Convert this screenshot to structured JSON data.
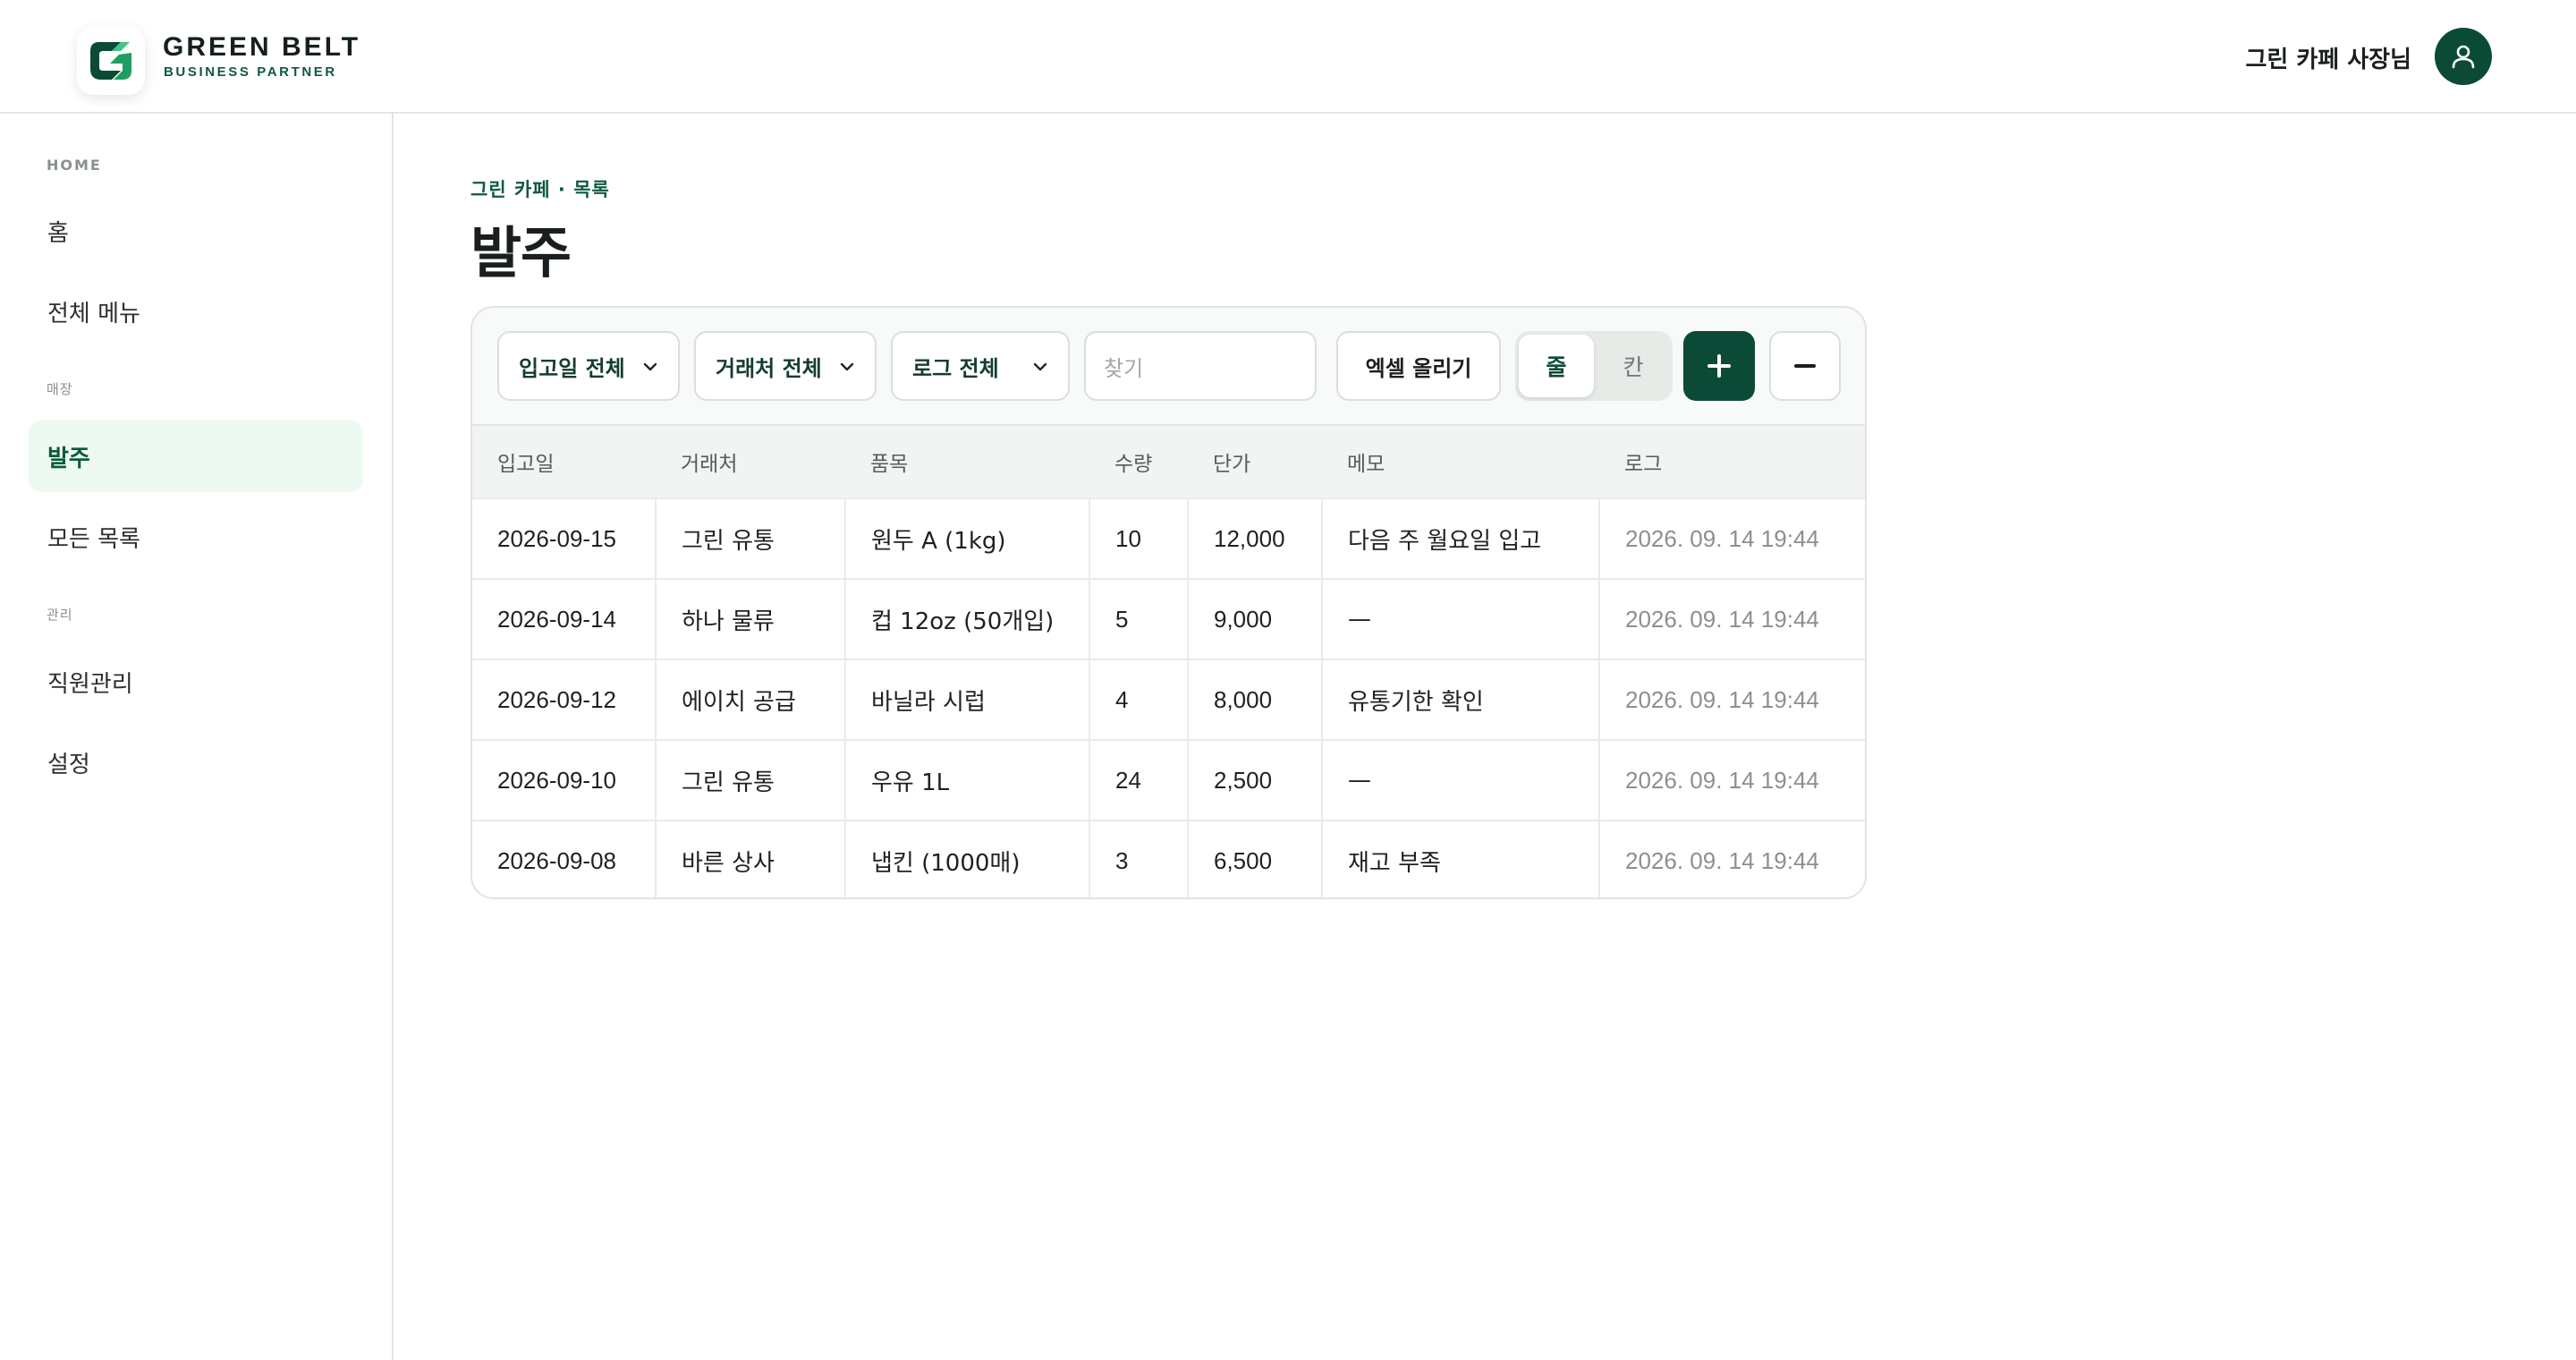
{
  "brand": {
    "name": "GREEN BELT",
    "tagline": "BUSINESS PARTNER"
  },
  "user": {
    "name": "그린 카페 사장님"
  },
  "sidebar": {
    "sections": [
      {
        "label": "HOME"
      },
      {
        "label": "매장"
      },
      {
        "label": "관리"
      }
    ],
    "items": [
      {
        "label": "홈",
        "active": false
      },
      {
        "label": "전체 메뉴",
        "active": false
      },
      {
        "label": "발주",
        "active": true
      },
      {
        "label": "모든 목록",
        "active": false
      },
      {
        "label": "직원관리",
        "active": false
      },
      {
        "label": "설정",
        "active": false
      }
    ]
  },
  "page": {
    "breadcrumb": "그린 카페 · 목록",
    "title": "발주"
  },
  "toolbar": {
    "filter_date": "입고일 전체",
    "filter_vendor": "거래처 전체",
    "filter_log": "로그 전체",
    "search_placeholder": "찾기",
    "excel_label": "엑셀 올리기",
    "view_row": "줄",
    "view_grid": "칸",
    "selected_view": "줄"
  },
  "table": {
    "columns": [
      "입고일",
      "거래처",
      "품목",
      "수량",
      "단가",
      "메모",
      "로그"
    ],
    "rows": [
      [
        "2026-09-15",
        "그린 유통",
        "원두 A (1kg)",
        "10",
        "12,000",
        "다음 주 월요일 입고",
        "2026. 09. 14 19:44"
      ],
      [
        "2026-09-14",
        "하나 물류",
        "컵 12oz (50개입)",
        "5",
        "9,000",
        "—",
        "2026. 09. 14 19:44"
      ],
      [
        "2026-09-12",
        "에이치 공급",
        "바닐라 시럽",
        "4",
        "8,000",
        "유통기한 확인",
        "2026. 09. 14 19:44"
      ],
      [
        "2026-09-10",
        "그린 유통",
        "우유 1L",
        "24",
        "2,500",
        "—",
        "2026. 09. 14 19:44"
      ],
      [
        "2026-09-08",
        "바른 상사",
        "냅킨 (1000매)",
        "3",
        "6,500",
        "재고 부족",
        "2026. 09. 14 19:44"
      ]
    ]
  },
  "colors": {
    "primary": "#0b4a36",
    "accent_text": "#0f5a3e",
    "active_bg": "#ecfaf2",
    "logo_green": "#1e9e63"
  },
  "icons": {
    "logo": "green-belt-g-logo-icon",
    "avatar": "user-icon",
    "dropdown": "chevron-down-icon",
    "add": "plus-icon",
    "remove": "minus-icon"
  }
}
